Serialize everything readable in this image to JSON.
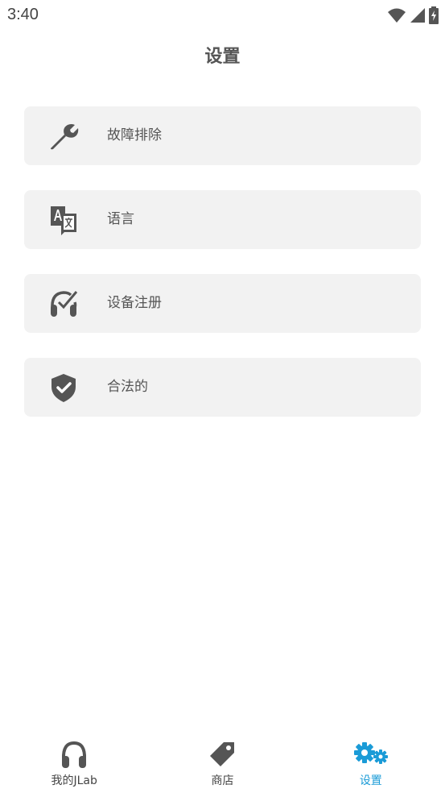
{
  "status_bar": {
    "time": "3:40",
    "icons": [
      "wifi-icon",
      "signal-icon",
      "battery-charging-icon"
    ]
  },
  "page": {
    "title": "设置"
  },
  "settings": {
    "items": [
      {
        "label": "故障排除",
        "icon": "wrench-icon"
      },
      {
        "label": "语言",
        "icon": "translate-icon"
      },
      {
        "label": "设备注册",
        "icon": "headphones-check-icon"
      },
      {
        "label": "合法的",
        "icon": "shield-check-icon"
      }
    ]
  },
  "bottom_nav": {
    "items": [
      {
        "label": "我的JLab",
        "icon": "headphones-icon",
        "active": false
      },
      {
        "label": "商店",
        "icon": "tag-icon",
        "active": false
      },
      {
        "label": "设置",
        "icon": "gears-icon",
        "active": true
      }
    ]
  },
  "colors": {
    "background": "#ffffff",
    "card": "#f2f2f2",
    "icon": "#555555",
    "text": "#555555",
    "active": "#1a9bd7"
  }
}
